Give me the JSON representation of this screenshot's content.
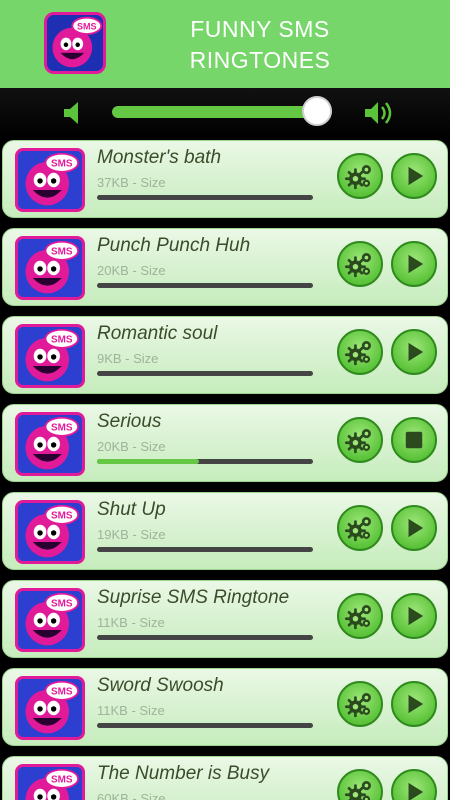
{
  "header": {
    "title_line1": "FUNNY SMS",
    "title_line2": "RINGTONES",
    "icon": "sms-smiley-icon"
  },
  "volume": {
    "low_icon": "speaker-low-icon",
    "high_icon": "speaker-high-icon",
    "level": 0.93
  },
  "colors": {
    "header_bg": "#76d66a",
    "accent": "#64c845"
  },
  "ringtones": [
    {
      "name": "Monster's bath",
      "size": "37KB - Size",
      "progress": 0,
      "state": "play"
    },
    {
      "name": "Punch Punch Huh",
      "size": "20KB - Size",
      "progress": 0,
      "state": "play"
    },
    {
      "name": "Romantic soul",
      "size": "9KB - Size",
      "progress": 0,
      "state": "play"
    },
    {
      "name": "Serious",
      "size": "20KB - Size",
      "progress": 0.47,
      "state": "stop"
    },
    {
      "name": "Shut Up",
      "size": "19KB - Size",
      "progress": 0,
      "state": "play"
    },
    {
      "name": "Suprise SMS Ringtone",
      "size": "11KB - Size",
      "progress": 0,
      "state": "play"
    },
    {
      "name": "Sword Swoosh",
      "size": "11KB - Size",
      "progress": 0,
      "state": "play"
    },
    {
      "name": "The Number is Busy",
      "size": "60KB - Size",
      "progress": 0,
      "state": "play"
    }
  ]
}
